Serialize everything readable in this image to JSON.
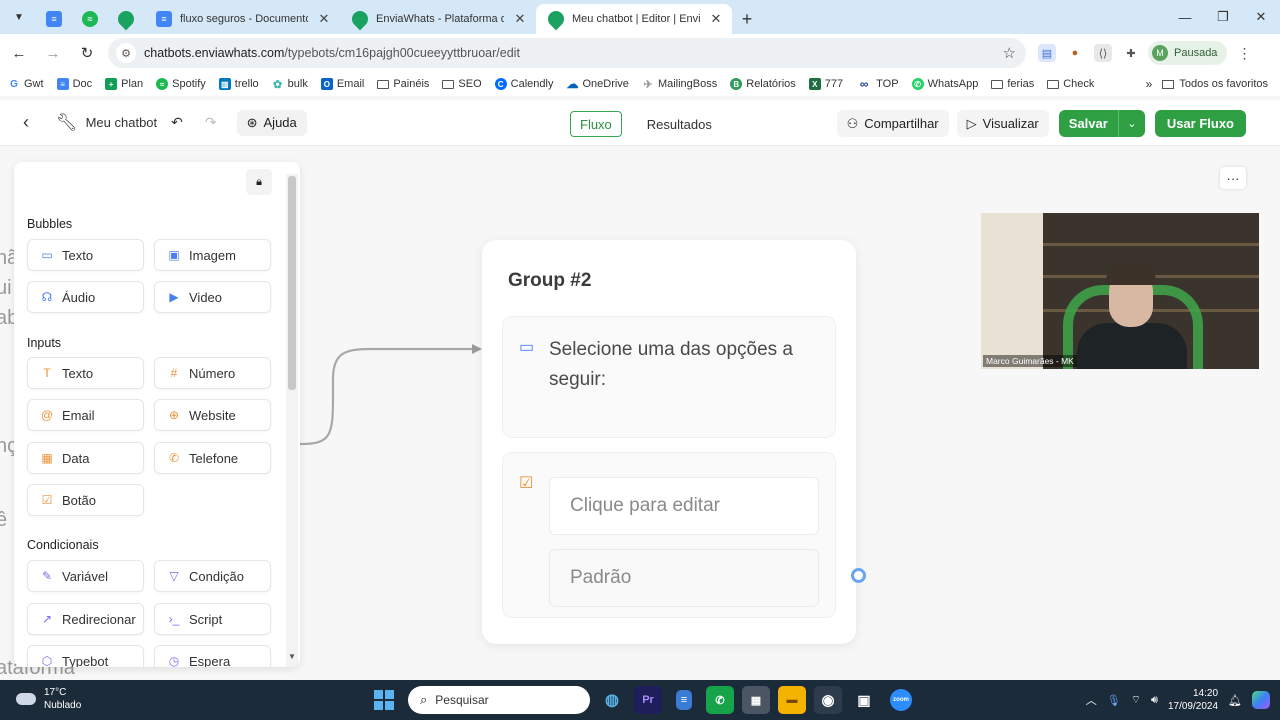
{
  "browser": {
    "tabs": [
      {
        "title": "fluxo seguros - Documentos Go",
        "favicon": "docs-icon"
      },
      {
        "title": "EnviaWhats - Plataforma de ate",
        "favicon": "enviawhats-icon"
      },
      {
        "title": "Meu chatbot | Editor | EnviaWh",
        "favicon": "enviawhats-icon",
        "active": true
      }
    ],
    "url_host": "chatbots.enviawhats.com",
    "url_path": "/typebots/cm16pajgh00cueeyyttbruoar/edit",
    "profile_initial": "M",
    "profile_label": "Pausada",
    "bookmarks": [
      {
        "label": "Gwt",
        "icon": "google-icon"
      },
      {
        "label": "Doc",
        "icon": "docs-icon"
      },
      {
        "label": "Plan",
        "icon": "sheets-icon"
      },
      {
        "label": "Spotify",
        "icon": "spotify-icon"
      },
      {
        "label": "trello",
        "icon": "trello-icon"
      },
      {
        "label": "bulk",
        "icon": "bulk-icon"
      },
      {
        "label": "Email",
        "icon": "outlook-icon"
      },
      {
        "label": "Painéis",
        "icon": "folder-icon"
      },
      {
        "label": "SEO",
        "icon": "folder-icon"
      },
      {
        "label": "Calendly",
        "icon": "calendly-icon"
      },
      {
        "label": "OneDrive",
        "icon": "onedrive-icon"
      },
      {
        "label": "MailingBoss",
        "icon": "mailingboss-icon"
      },
      {
        "label": "Relatórios",
        "icon": "b-icon"
      },
      {
        "label": "777",
        "icon": "excel-icon"
      },
      {
        "label": "TOP",
        "icon": "infinity-icon"
      },
      {
        "label": "WhatsApp",
        "icon": "whatsapp-icon"
      },
      {
        "label": "ferias",
        "icon": "folder-icon"
      },
      {
        "label": "Check",
        "icon": "folder-icon"
      }
    ],
    "bookmarks_all": "Todos os favoritos"
  },
  "app": {
    "bot_name": "Meu chatbot",
    "help_label": "Ajuda",
    "tab_flow": "Fluxo",
    "tab_results": "Resultados",
    "share_label": "Compartilhar",
    "preview_label": "Visualizar",
    "save_label": "Salvar",
    "use_flow_label": "Usar Fluxo",
    "accent": "#2ea043"
  },
  "sidebar": {
    "sections": [
      {
        "title": "Bubbles",
        "items": [
          {
            "label": "Texto",
            "icon": "chat-bubble-icon"
          },
          {
            "label": "Imagem",
            "icon": "image-icon"
          },
          {
            "label": "Áudio",
            "icon": "headphones-icon"
          },
          {
            "label": "Video",
            "icon": "play-icon"
          }
        ]
      },
      {
        "title": "Inputs",
        "items": [
          {
            "label": "Texto",
            "icon": "text-t-icon"
          },
          {
            "label": "Número",
            "icon": "hash-icon"
          },
          {
            "label": "Email",
            "icon": "at-icon"
          },
          {
            "label": "Website",
            "icon": "globe-icon"
          },
          {
            "label": "Data",
            "icon": "calendar-icon"
          },
          {
            "label": "Telefone",
            "icon": "phone-icon"
          },
          {
            "label": "Botão",
            "icon": "checkbox-icon"
          }
        ]
      },
      {
        "title": "Condicionais",
        "items": [
          {
            "label": "Variável",
            "icon": "pencil-icon"
          },
          {
            "label": "Condição",
            "icon": "filter-icon"
          },
          {
            "label": "Redirecionar",
            "icon": "external-link-icon"
          },
          {
            "label": "Script",
            "icon": "terminal-icon"
          },
          {
            "label": "Typebot",
            "icon": "cube-icon"
          },
          {
            "label": "Espera",
            "icon": "clock-icon"
          }
        ]
      }
    ]
  },
  "canvas": {
    "group_title": "Group #2",
    "text_bubble": "Selecione uma das opções a seguir:",
    "button_placeholder": "Clique para editar",
    "default_button": "Padrão",
    "ghost_texts": [
      "nã",
      "ui",
      "ab",
      "nç",
      "ê",
      "ataforma"
    ]
  },
  "webcam": {
    "name_label": "Marco Guimarães - MK"
  },
  "taskbar": {
    "temperature": "17°C",
    "weather": "Nublado",
    "search_placeholder": "Pesquisar",
    "time": "14:20",
    "date": "17/09/2024"
  }
}
